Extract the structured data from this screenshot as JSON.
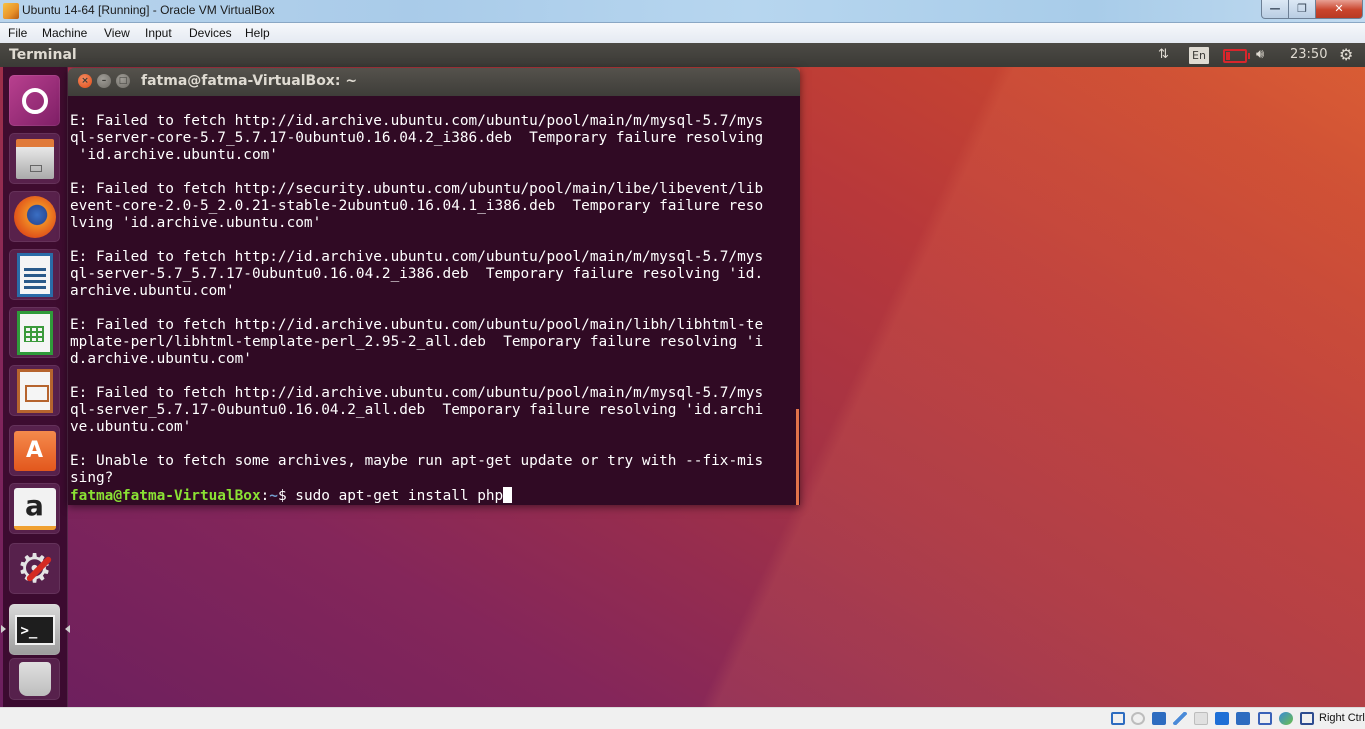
{
  "host_window": {
    "title": "Ubuntu 14-64 [Running] - Oracle VM VirtualBox",
    "controls": {
      "minimize": "—",
      "maximize": "❐",
      "close": "✕"
    }
  },
  "vbox_menu": [
    "File",
    "Machine",
    "View",
    "Input",
    "Devices",
    "Help"
  ],
  "ubuntu_panel": {
    "app_title": "Terminal",
    "indicators": {
      "network_icon": "network-updown-icon",
      "keyboard_layout": "En",
      "battery_icon": "battery-low-icon",
      "volume_icon": "volume-icon",
      "clock": "23:50",
      "session_icon": "gear-power-icon"
    }
  },
  "launcher": {
    "items": [
      {
        "name": "dash-home",
        "icon": "ubuntu-logo-icon"
      },
      {
        "name": "files",
        "icon": "file-cabinet-icon"
      },
      {
        "name": "firefox",
        "icon": "firefox-icon"
      },
      {
        "name": "libreoffice-writer",
        "icon": "writer-icon"
      },
      {
        "name": "libreoffice-calc",
        "icon": "calc-icon"
      },
      {
        "name": "libreoffice-impress",
        "icon": "impress-icon"
      },
      {
        "name": "ubuntu-software",
        "icon": "software-bag-icon"
      },
      {
        "name": "amazon",
        "icon": "amazon-icon"
      },
      {
        "name": "system-settings",
        "icon": "settings-wrench-icon"
      },
      {
        "name": "terminal",
        "icon": "terminal-icon",
        "active": true
      },
      {
        "name": "trash",
        "icon": "trash-icon"
      }
    ]
  },
  "terminal": {
    "title": "fatma@fatma-VirtualBox: ~",
    "window_buttons": {
      "close": "×",
      "minimize": "–",
      "maximize": "□"
    },
    "output_lines": [
      "E: Failed to fetch http://id.archive.ubuntu.com/ubuntu/pool/main/m/mysql-5.7/mys",
      "ql-server-core-5.7_5.7.17-0ubuntu0.16.04.2_i386.deb  Temporary failure resolving",
      " 'id.archive.ubuntu.com'",
      "",
      "E: Failed to fetch http://security.ubuntu.com/ubuntu/pool/main/libe/libevent/lib",
      "event-core-2.0-5_2.0.21-stable-2ubuntu0.16.04.1_i386.deb  Temporary failure reso",
      "lving 'id.archive.ubuntu.com'",
      "",
      "E: Failed to fetch http://id.archive.ubuntu.com/ubuntu/pool/main/m/mysql-5.7/mys",
      "ql-server-5.7_5.7.17-0ubuntu0.16.04.2_i386.deb  Temporary failure resolving 'id.",
      "archive.ubuntu.com'",
      "",
      "E: Failed to fetch http://id.archive.ubuntu.com/ubuntu/pool/main/libh/libhtml-te",
      "mplate-perl/libhtml-template-perl_2.95-2_all.deb  Temporary failure resolving 'i",
      "d.archive.ubuntu.com'",
      "",
      "E: Failed to fetch http://id.archive.ubuntu.com/ubuntu/pool/main/m/mysql-5.7/mys",
      "ql-server_5.7.17-0ubuntu0.16.04.2_all.deb  Temporary failure resolving 'id.archi",
      "ve.ubuntu.com'",
      "",
      "E: Unable to fetch some archives, maybe run apt-get update or try with --fix-mis",
      "sing?"
    ],
    "prompt": {
      "user_host": "fatma@fatma-VirtualBox",
      "separator": ":",
      "path": "~",
      "symbol": "$ ",
      "command": "sudo apt-get install php"
    },
    "colors": {
      "background": "#300a24",
      "prompt_user": "#8ae234",
      "prompt_path": "#729fcf",
      "scrollbar": "#e2734a"
    }
  },
  "vbox_status": {
    "icons": [
      "hard-disk-icon",
      "optical-drive-icon",
      "audio-icon",
      "usb-icon",
      "shared-folders-icon",
      "display-icon",
      "network-icon",
      "video-capture-icon",
      "cpu-icon",
      "mouse-integration-icon",
      "keyboard-capture-icon"
    ],
    "host_key": "Right Ctrl"
  }
}
